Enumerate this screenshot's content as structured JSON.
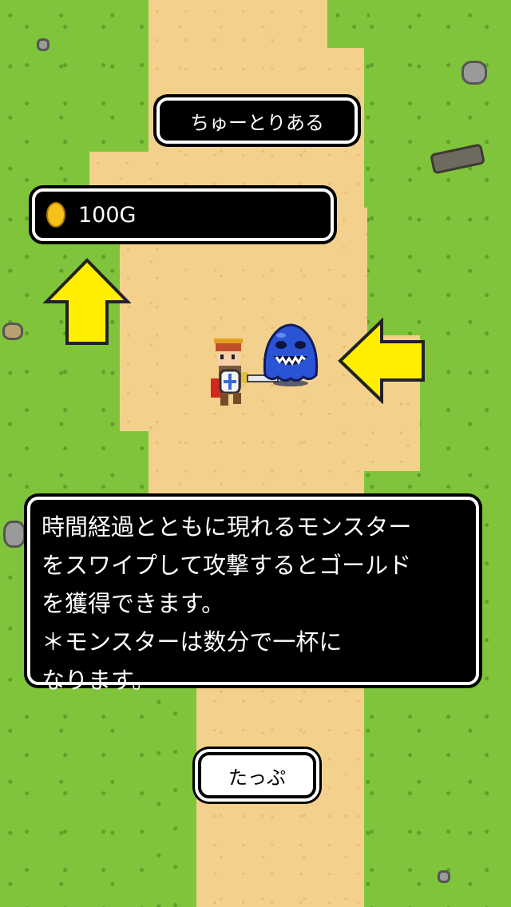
{
  "screen": {
    "title_button": "ちゅーとりある",
    "gold": {
      "amount": "100G",
      "coin_icon": "gold-coin-icon"
    },
    "tutorial_message": {
      "lines": [
        "時間経過とともに現れるモンスター",
        "をスワイプして攻撃するとゴールド",
        "を獲得できます。",
        "＊モンスターは数分で一杯に",
        "なります。"
      ]
    },
    "tap_button": "たっぷ"
  },
  "colors": {
    "grass": "#80c43b",
    "path": "#f3d18c",
    "arrow": "#ffee00",
    "panel": "#000000",
    "panel_border": "#ffffff",
    "monster": "#2b53d6"
  },
  "icons": [
    "up-arrow-icon",
    "left-arrow-icon",
    "hero-sprite",
    "blue-slime-monster",
    "gold-coin-icon"
  ]
}
